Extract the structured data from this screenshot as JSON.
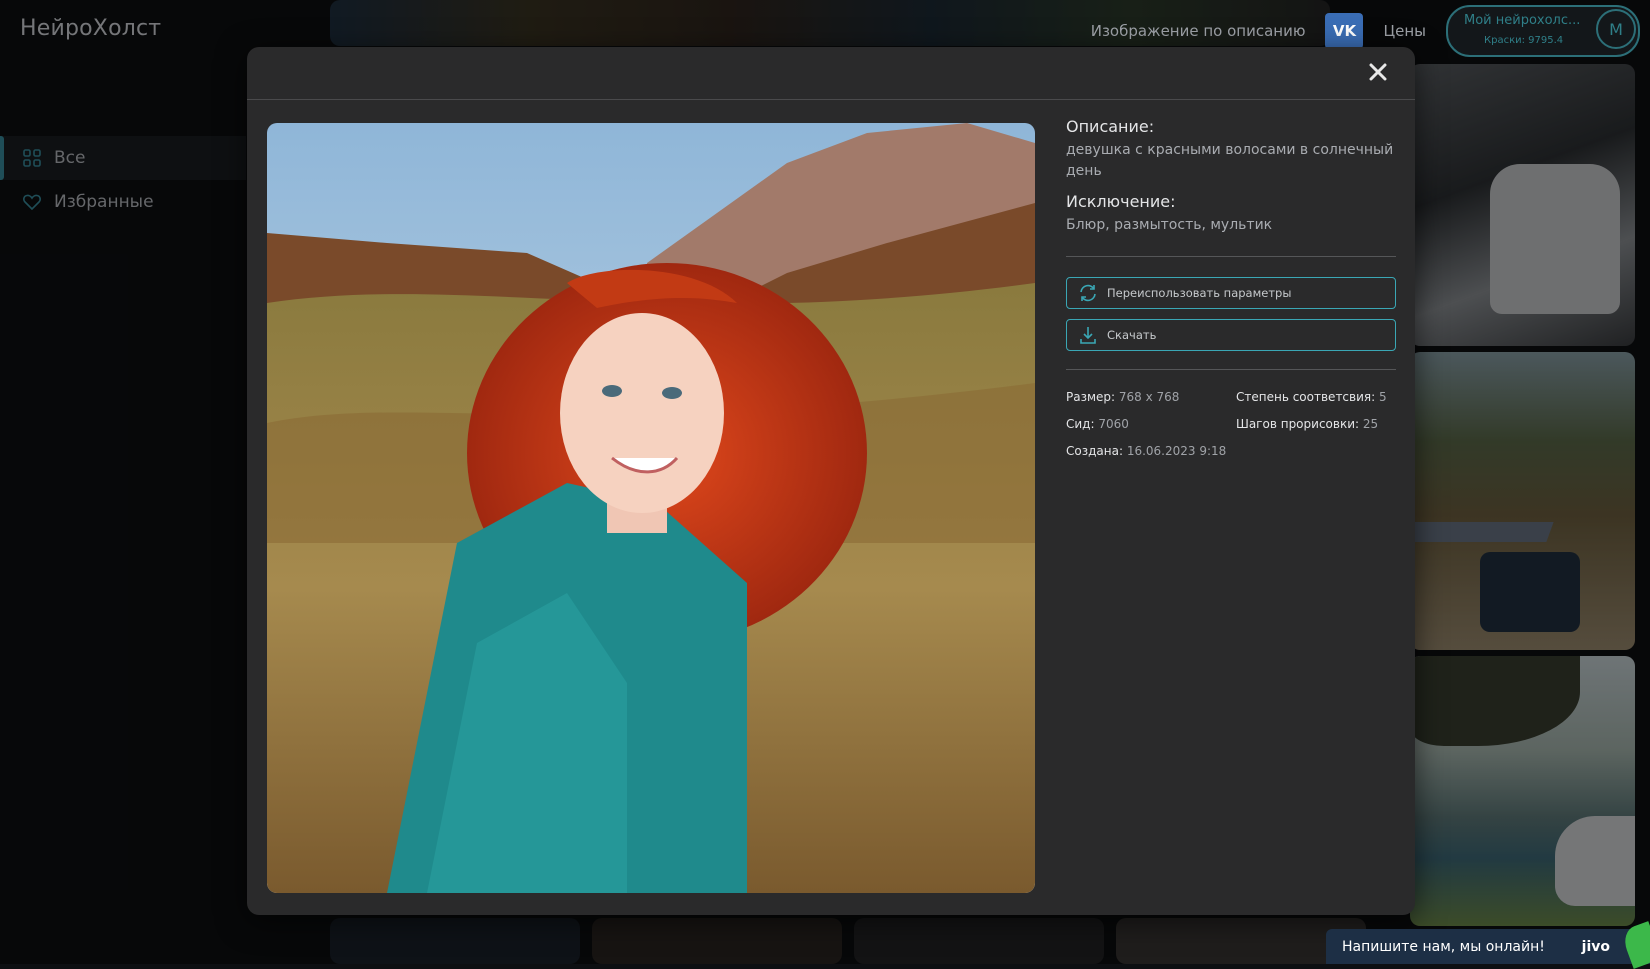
{
  "app": {
    "logo": "НейроХолст"
  },
  "sidebar": {
    "items": [
      {
        "label": "Все",
        "icon": "grid-icon",
        "active": true
      },
      {
        "label": "Избранные",
        "icon": "heart-icon",
        "active": false
      }
    ]
  },
  "topnav": {
    "link_text2img": "Изображение по описанию",
    "vk_label": "VK",
    "prices": "Цены",
    "account_name": "Мой нейрохолс...",
    "account_balance": "Краски: 9795.4",
    "avatar_letter": "M"
  },
  "modal": {
    "description_label": "Описание:",
    "description_value": "девушка с красными волосами в солнечный день",
    "exclusion_label": "Исключение:",
    "exclusion_value": "Блюр, размытость, мультик",
    "reuse_button": "Переиспользовать параметры",
    "download_button": "Скачать",
    "meta": {
      "size_label": "Размер:",
      "size_value": "768 x 768",
      "cfg_label": "Степень соответсвия:",
      "cfg_value": "5",
      "seed_label": "Сид:",
      "seed_value": "7060",
      "steps_label": "Шагов прорисовки:",
      "steps_value": "25",
      "created_label": "Создана:",
      "created_value": "16.06.2023 9:18"
    }
  },
  "chat": {
    "text": "Напишите нам, мы онлайн!",
    "brand": "jivo"
  },
  "colors": {
    "accent": "#3aa7b5",
    "modal_bg": "#2a2a2b",
    "page_bg": "#0d0f12",
    "chat_bg": "#1d2f45"
  }
}
